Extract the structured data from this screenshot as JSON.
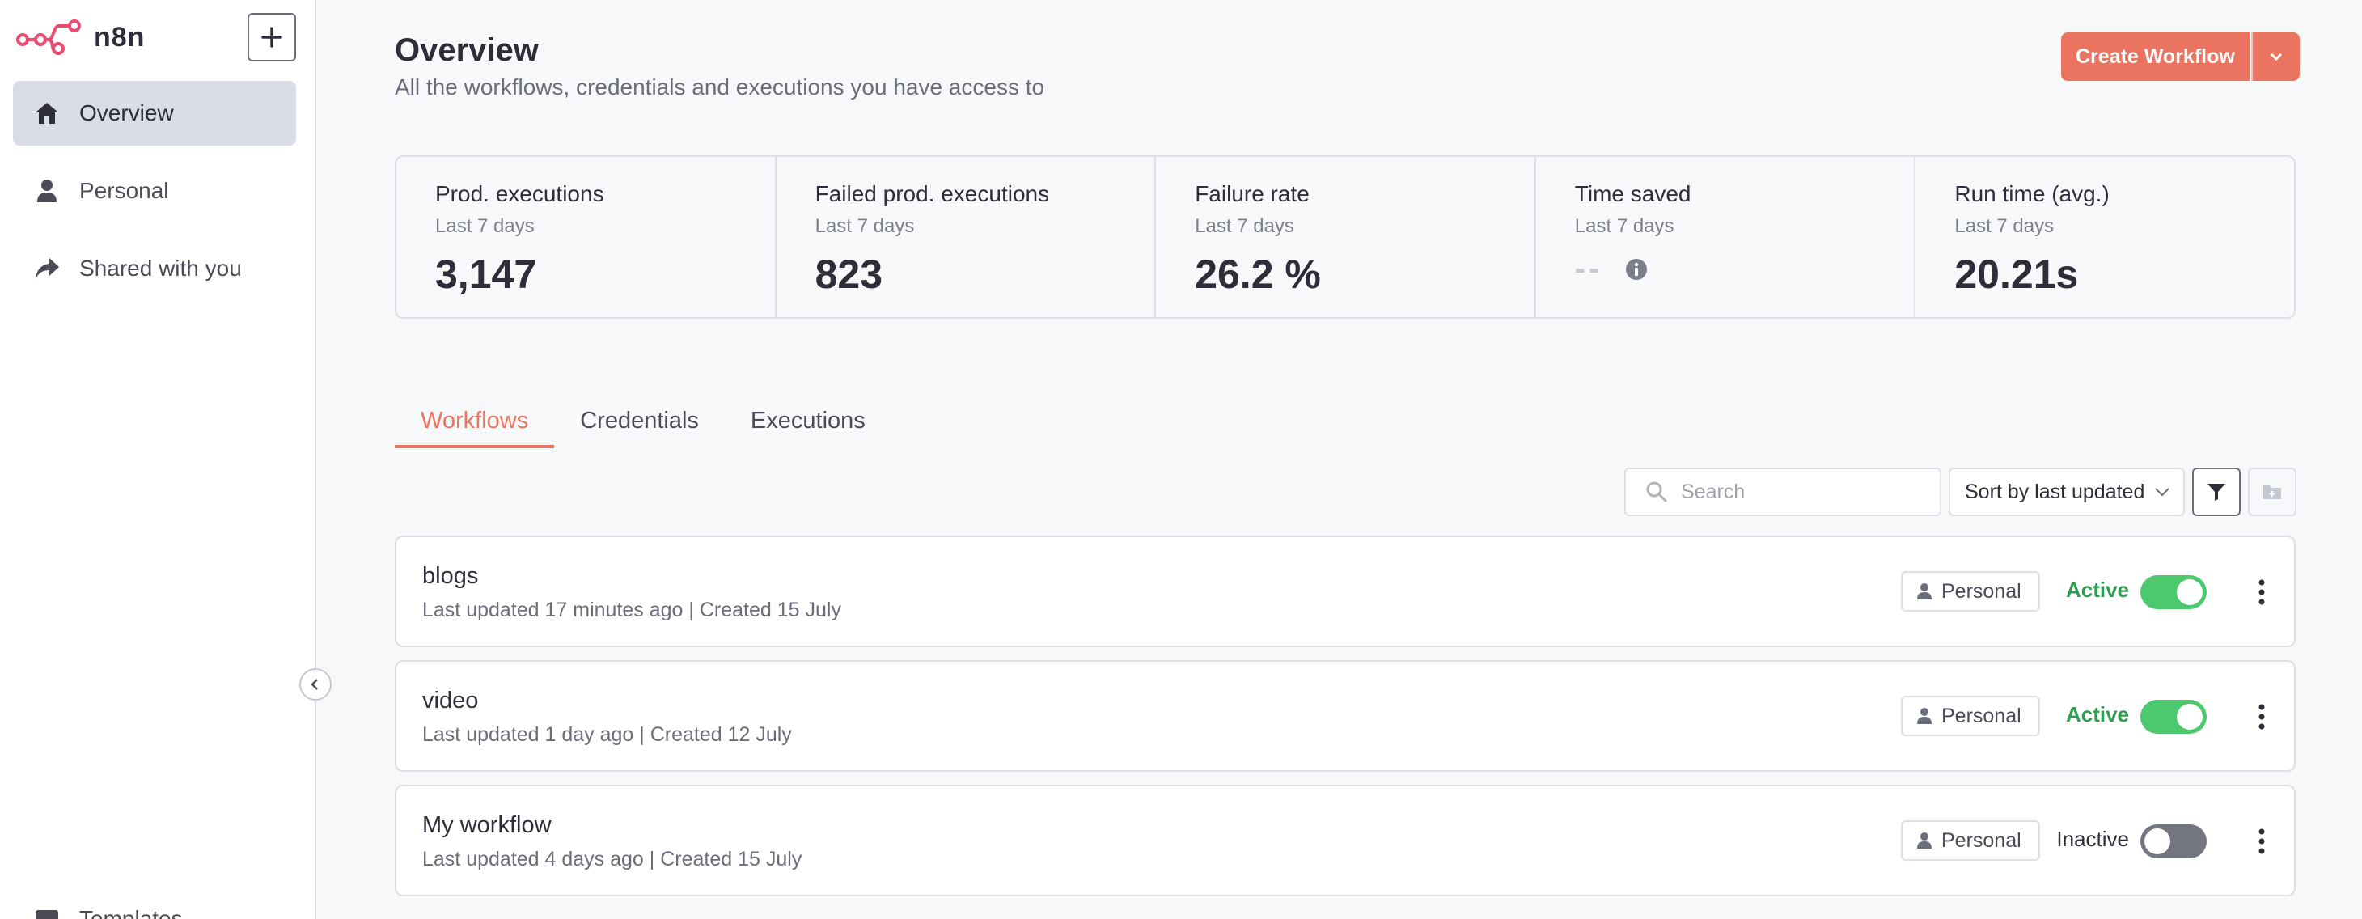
{
  "brand": {
    "name": "n8n"
  },
  "sidebar": {
    "items": [
      {
        "label": "Overview",
        "icon": "home-icon",
        "active": true
      },
      {
        "label": "Personal",
        "icon": "user-icon",
        "active": false
      },
      {
        "label": "Shared with you",
        "icon": "share-icon",
        "active": false
      }
    ],
    "templates_label": "Templates"
  },
  "header": {
    "title": "Overview",
    "subtitle": "All the workflows, credentials and executions you have access to",
    "create_label": "Create Workflow"
  },
  "stats": [
    {
      "title": "Prod. executions",
      "period": "Last 7 days",
      "value": "3,147"
    },
    {
      "title": "Failed prod. executions",
      "period": "Last 7 days",
      "value": "823"
    },
    {
      "title": "Failure rate",
      "period": "Last 7 days",
      "value": "26.2 %"
    },
    {
      "title": "Time saved",
      "period": "Last 7 days",
      "value": "--"
    },
    {
      "title": "Run time (avg.)",
      "period": "Last 7 days",
      "value": "20.21s"
    }
  ],
  "tabs": [
    {
      "label": "Workflows",
      "active": true
    },
    {
      "label": "Credentials",
      "active": false
    },
    {
      "label": "Executions",
      "active": false
    }
  ],
  "toolbar": {
    "search_placeholder": "Search",
    "sort_label": "Sort by last updated"
  },
  "workflows": [
    {
      "name": "blogs",
      "meta": "Last updated 17 minutes ago | Created 15 July",
      "owner": "Personal",
      "status": "Active",
      "active": true
    },
    {
      "name": "video",
      "meta": "Last updated 1 day ago | Created 12 July",
      "owner": "Personal",
      "status": "Active",
      "active": true
    },
    {
      "name": "My workflow",
      "meta": "Last updated 4 days ago | Created 15 July",
      "owner": "Personal",
      "status": "Inactive",
      "active": false
    }
  ],
  "colors": {
    "accent": "#ea7460",
    "active_green": "#4cc86e",
    "sidebar_active": "#dadde5"
  }
}
